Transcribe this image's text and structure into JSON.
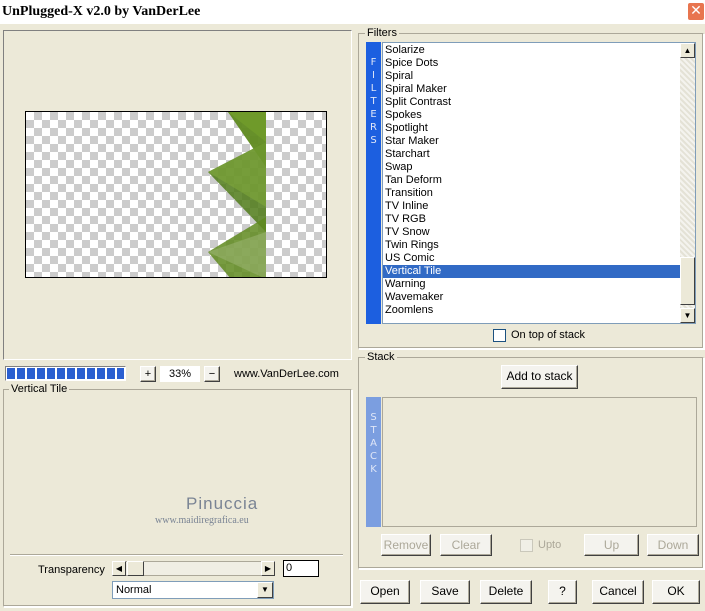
{
  "window": {
    "title": "UnPlugged-X v2.0 by VanDerLee",
    "close_glyph": "✕"
  },
  "preview": {
    "zoom_minus": "−",
    "zoom_plus": "+",
    "zoom_value": "33%",
    "website": "www.VanDerLee.com",
    "progress_fraction": 1.0
  },
  "settings": {
    "title": "Vertical Tile",
    "watermark_name": "Pinuccia",
    "watermark_url": "www.maidiregrafica.eu",
    "transparency_label": "Transparency",
    "transparency_value": "0",
    "blend_mode": "Normal"
  },
  "filters": {
    "group_label": "Filters",
    "side_tab": [
      "F",
      "I",
      "L",
      "T",
      "E",
      "R",
      "S"
    ],
    "items": [
      "Solarize",
      "Spice Dots",
      "Spiral",
      "Spiral Maker",
      "Split Contrast",
      "Spokes",
      "Spotlight",
      "Star Maker",
      "Starchart",
      "Swap",
      "Tan Deform",
      "Transition",
      "TV Inline",
      "TV RGB",
      "TV Snow",
      "Twin Rings",
      "US Comic",
      "Vertical Tile",
      "Warning",
      "Wavemaker",
      "Zoomlens"
    ],
    "selected": "Vertical Tile",
    "on_top_label": "On top of stack"
  },
  "stack": {
    "group_label": "Stack",
    "add_button": "Add to stack",
    "side_tab": [
      "S",
      "T",
      "A",
      "C",
      "K"
    ],
    "remove_button": "Remove",
    "clear_button": "Clear",
    "upto_label": "Upto",
    "up_button": "Up",
    "down_button": "Down"
  },
  "footer": {
    "open": "Open",
    "save": "Save",
    "delete": "Delete",
    "help": "?",
    "cancel": "Cancel",
    "ok": "OK"
  },
  "colors": {
    "accent": "#316ac5",
    "filter_tab": "#1c5fe0",
    "stack_tab": "#7b9ee0",
    "leaf_green": "#5f8a1f"
  }
}
